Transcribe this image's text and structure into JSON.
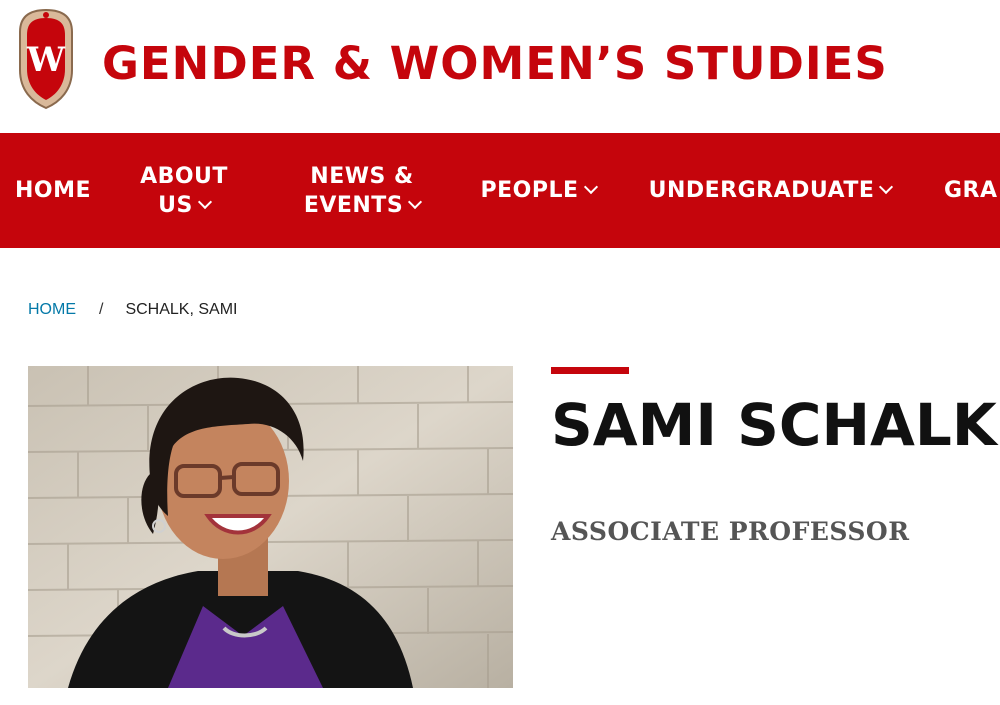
{
  "header": {
    "logo_letter": "W",
    "site_title": "GENDER & WOMEN’S STUDIES"
  },
  "nav": {
    "items": [
      {
        "line1": "HOME",
        "line2": ""
      },
      {
        "line1": "ABOUT",
        "line2": "US"
      },
      {
        "line1": "NEWS &",
        "line2": "EVENTS"
      },
      {
        "line1": "PEOPLE",
        "line2": ""
      },
      {
        "line1": "UNDERGRADUATE",
        "line2": ""
      },
      {
        "line1": "GRA",
        "line2": ""
      }
    ]
  },
  "breadcrumb": {
    "home": "HOME",
    "separator": "/",
    "current": "SCHALK, SAMI"
  },
  "profile": {
    "name": "SAMI SCHALK",
    "title": "ASSOCIATE PROFESSOR"
  },
  "colors": {
    "brand_red": "#c5050c",
    "link_blue": "#0479a8"
  }
}
